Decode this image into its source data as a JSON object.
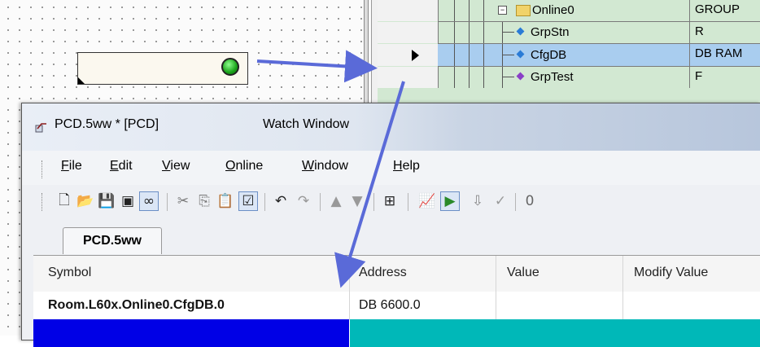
{
  "tree": {
    "rows": [
      {
        "name": "Online0",
        "type": "GROUP",
        "icon": "folder-icon"
      },
      {
        "name": "GrpStn",
        "type": "R",
        "icon": "diamond-blue-icon"
      },
      {
        "name": "CfgDB",
        "type": "DB RAM",
        "icon": "diamond-blue-icon",
        "selected": true
      },
      {
        "name": "GrpTest",
        "type": "F",
        "icon": "diamond-purple-icon"
      }
    ]
  },
  "window": {
    "title": "PCD.5ww * [PCD]",
    "doc_title": "Watch Window"
  },
  "menu": {
    "items": [
      {
        "label": "File",
        "key": "F"
      },
      {
        "label": "Edit",
        "key": "E"
      },
      {
        "label": "View",
        "key": "V"
      },
      {
        "label": "Online",
        "key": "O"
      },
      {
        "label": "Window",
        "key": "W"
      },
      {
        "label": "Help",
        "key": "H"
      }
    ]
  },
  "toolbar": {
    "counter_text": "0"
  },
  "tab": {
    "label": "PCD.5ww"
  },
  "grid": {
    "columns": [
      "Symbol",
      "Address",
      "Value",
      "Modify Value"
    ],
    "rows": [
      {
        "symbol": "Room.L60x.Online0.CfgDB.0",
        "address": "DB 6600.0",
        "value": "",
        "modify": ""
      }
    ]
  },
  "colors": {
    "tree_bg": "#d2e8d2",
    "selected_row": "#a9cdef",
    "arrow": "#5a6ad8",
    "led": "#1aa31a",
    "grid_row2_left": "#0000e6",
    "grid_row2_right": "#00b8b8"
  }
}
